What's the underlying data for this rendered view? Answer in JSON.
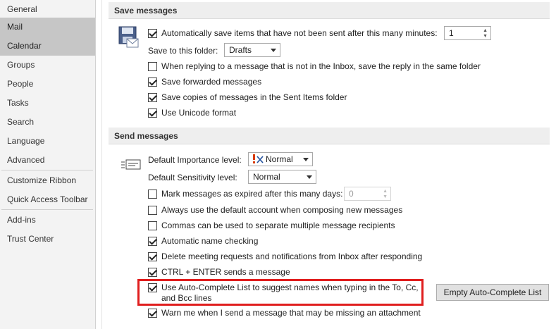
{
  "sidebar": {
    "items": [
      {
        "label": "General"
      },
      {
        "label": "Mail"
      },
      {
        "label": "Calendar"
      },
      {
        "label": "Groups"
      },
      {
        "label": "People"
      },
      {
        "label": "Tasks"
      },
      {
        "label": "Search"
      },
      {
        "label": "Language"
      },
      {
        "label": "Advanced"
      },
      {
        "label": "Customize Ribbon"
      },
      {
        "label": "Quick Access Toolbar"
      },
      {
        "label": "Add-ins"
      },
      {
        "label": "Trust Center"
      }
    ]
  },
  "save_messages": {
    "header": "Save messages",
    "autosave_label": "Automatically save items that have not been sent after this many minutes:",
    "autosave_minutes": "1",
    "save_folder_label": "Save to this folder:",
    "save_folder_value": "Drafts",
    "reply_same_folder": "When replying to a message that is not in the Inbox, save the reply in the same folder",
    "save_forwarded": "Save forwarded messages",
    "save_copies_sent": "Save copies of messages in the Sent Items folder",
    "use_unicode": "Use Unicode format"
  },
  "send_messages": {
    "header": "Send messages",
    "importance_label": "Default Importance level:",
    "importance_value": "Normal",
    "sensitivity_label": "Default Sensitivity level:",
    "sensitivity_value": "Normal",
    "mark_expired": "Mark messages as expired after this many days:",
    "expired_days": "0",
    "always_default_account": "Always use the default account when composing new messages",
    "commas_separate": "Commas can be used to separate multiple message recipients",
    "auto_name_check": "Automatic name checking",
    "delete_meeting_requests": "Delete meeting requests and notifications from Inbox after responding",
    "ctrl_enter": "CTRL + ENTER sends a message",
    "autocomplete_line1": "Use Auto-Complete List to suggest names when typing in the To, Cc,",
    "autocomplete_line2": "and Bcc lines",
    "empty_autocomplete_button": "Empty Auto-Complete List",
    "warn_missing_attachment": "Warn me when I send a message that may be missing an attachment"
  },
  "colors": {
    "highlight": "#e01e1e",
    "sidebar_selected": "#c6c6c6"
  }
}
